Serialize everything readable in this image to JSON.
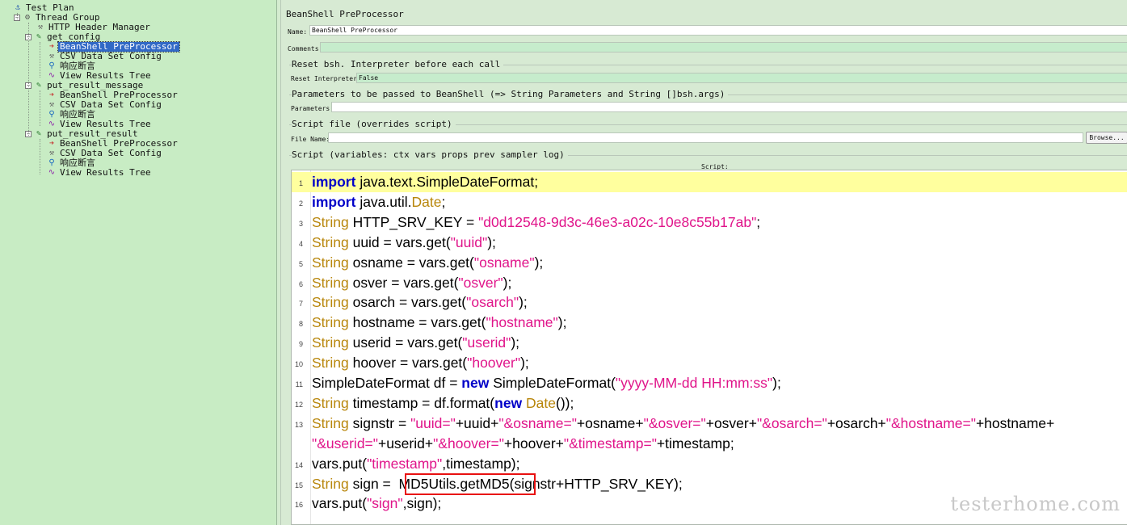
{
  "tree": {
    "items": [
      {
        "label": "Test Plan",
        "icon": "test-plan-icon"
      },
      {
        "label": "Thread Group",
        "icon": "thread-group-icon"
      },
      {
        "label": "HTTP Header Manager",
        "icon": "wrench-icon"
      },
      {
        "label": "get_config",
        "icon": "sampler-icon"
      },
      {
        "label": "BeanShell PreProcessor",
        "icon": "preprocessor-icon"
      },
      {
        "label": "CSV Data Set Config",
        "icon": "wrench-icon"
      },
      {
        "label": "响应断言",
        "icon": "magnifier-icon"
      },
      {
        "label": "View Results Tree",
        "icon": "graph-icon"
      },
      {
        "label": "put_result_message",
        "icon": "sampler-icon"
      },
      {
        "label": "BeanShell PreProcessor",
        "icon": "preprocessor-icon"
      },
      {
        "label": "CSV Data Set Config",
        "icon": "wrench-icon"
      },
      {
        "label": "响应断言",
        "icon": "magnifier-icon"
      },
      {
        "label": "View Results Tree",
        "icon": "graph-icon"
      },
      {
        "label": "put_result_result",
        "icon": "sampler-icon"
      },
      {
        "label": "BeanShell PreProcessor",
        "icon": "preprocessor-icon"
      },
      {
        "label": "CSV Data Set Config",
        "icon": "wrench-icon"
      },
      {
        "label": "响应断言",
        "icon": "magnifier-icon"
      },
      {
        "label": "View Results Tree",
        "icon": "graph-icon"
      }
    ],
    "selected_index": 4
  },
  "panel": {
    "title": "BeanShell PreProcessor",
    "name_label": "Name:",
    "name_value": "BeanShell PreProcessor",
    "comments_label": "Comments:",
    "comments_value": "",
    "reset_group": "Reset bsh. Interpreter before each call",
    "reset_label": "Reset Interpreter:",
    "reset_value": "False",
    "params_group": "Parameters to be passed to BeanShell (=> String Parameters and String []bsh.args)",
    "params_label": "Parameters:",
    "params_value": "",
    "file_group": "Script file (overrides script)",
    "file_label": "File Name:",
    "file_value": "",
    "browse_label": "Browse...",
    "script_group": "Script (variables: ctx vars props prev sampler log)",
    "script_label": "Script:"
  },
  "script": {
    "lines": [
      {
        "n": "1",
        "parts": [
          [
            "kw",
            "import"
          ],
          [
            "t",
            " java.text.SimpleDateFormat;"
          ]
        ]
      },
      {
        "n": "2",
        "parts": [
          [
            "kw",
            "import"
          ],
          [
            "t",
            " java.util."
          ],
          [
            "ty",
            "Date"
          ],
          [
            "t",
            ";"
          ]
        ]
      },
      {
        "n": "3",
        "parts": [
          [
            "ty",
            "String"
          ],
          [
            "t",
            " HTTP_SRV_KEY = "
          ],
          [
            "st",
            "\"d0d12548-9d3c-46e3-a02c-10e8c55b17ab\""
          ],
          [
            "t",
            ";"
          ]
        ]
      },
      {
        "n": "4",
        "parts": [
          [
            "ty",
            "String"
          ],
          [
            "t",
            " uuid = vars.get("
          ],
          [
            "st",
            "\"uuid\""
          ],
          [
            "t",
            ");"
          ]
        ]
      },
      {
        "n": "5",
        "parts": [
          [
            "ty",
            "String"
          ],
          [
            "t",
            " osname = vars.get("
          ],
          [
            "st",
            "\"osname\""
          ],
          [
            "t",
            ");"
          ]
        ]
      },
      {
        "n": "6",
        "parts": [
          [
            "ty",
            "String"
          ],
          [
            "t",
            " osver = vars.get("
          ],
          [
            "st",
            "\"osver\""
          ],
          [
            "t",
            ");"
          ]
        ]
      },
      {
        "n": "7",
        "parts": [
          [
            "ty",
            "String"
          ],
          [
            "t",
            " osarch = vars.get("
          ],
          [
            "st",
            "\"osarch\""
          ],
          [
            "t",
            ");"
          ]
        ]
      },
      {
        "n": "8",
        "parts": [
          [
            "ty",
            "String"
          ],
          [
            "t",
            " hostname = vars.get("
          ],
          [
            "st",
            "\"hostname\""
          ],
          [
            "t",
            ");"
          ]
        ]
      },
      {
        "n": "9",
        "parts": [
          [
            "ty",
            "String"
          ],
          [
            "t",
            " userid = vars.get("
          ],
          [
            "st",
            "\"userid\""
          ],
          [
            "t",
            ");"
          ]
        ]
      },
      {
        "n": "10",
        "parts": [
          [
            "ty",
            "String"
          ],
          [
            "t",
            " hoover = vars.get("
          ],
          [
            "st",
            "\"hoover\""
          ],
          [
            "t",
            ");"
          ]
        ]
      },
      {
        "n": "11",
        "parts": [
          [
            "t",
            "SimpleDateFormat df = "
          ],
          [
            "kw",
            "new"
          ],
          [
            "t",
            " SimpleDateFormat("
          ],
          [
            "st",
            "\"yyyy-MM-dd HH:mm:ss\""
          ],
          [
            "t",
            ");"
          ]
        ]
      },
      {
        "n": "12",
        "parts": [
          [
            "ty",
            "String"
          ],
          [
            "t",
            " timestamp = df.format("
          ],
          [
            "kw",
            "new"
          ],
          [
            "t",
            " "
          ],
          [
            "ty",
            "Date"
          ],
          [
            "t",
            "());"
          ]
        ]
      },
      {
        "n": "13",
        "parts": [
          [
            "ty",
            "String"
          ],
          [
            "t",
            " signstr = "
          ],
          [
            "st",
            "\"uuid=\""
          ],
          [
            "t",
            "+uuid+"
          ],
          [
            "st",
            "\"&osname=\""
          ],
          [
            "t",
            "+osname+"
          ],
          [
            "st",
            "\"&osver=\""
          ],
          [
            "t",
            "+osver+"
          ],
          [
            "st",
            "\"&osarch=\""
          ],
          [
            "t",
            "+osarch+"
          ],
          [
            "st",
            "\"&hostname=\""
          ],
          [
            "t",
            "+hostname+"
          ]
        ]
      },
      {
        "n": "",
        "parts": [
          [
            "st",
            "\"&userid=\""
          ],
          [
            "t",
            "+userid+"
          ],
          [
            "st",
            "\"&hoover=\""
          ],
          [
            "t",
            "+hoover+"
          ],
          [
            "st",
            "\"&timestamp=\""
          ],
          [
            "t",
            "+timestamp;"
          ]
        ]
      },
      {
        "n": "14",
        "parts": [
          [
            "t",
            "vars.put("
          ],
          [
            "st",
            "\"timestamp\""
          ],
          [
            "t",
            ",timestamp);"
          ]
        ]
      },
      {
        "n": "15",
        "parts": [
          [
            "ty",
            "String"
          ],
          [
            "t",
            " sign = "
          ],
          [
            "t",
            " MD5Utils.getMD5("
          ],
          [
            "t",
            "signstr+HTTP_SRV_KEY);"
          ]
        ]
      },
      {
        "n": "16",
        "parts": [
          [
            "t",
            "vars.put("
          ],
          [
            "st",
            "\"sign\""
          ],
          [
            "t",
            ",sign);"
          ]
        ]
      }
    ],
    "active_line": 0
  },
  "watermark": "testerhome.com",
  "colors": {
    "keyword": "#0000c8",
    "type": "#b8860b",
    "string": "#e0148a",
    "highlight_box": "#e81010",
    "active_line": "#ffff9e"
  }
}
